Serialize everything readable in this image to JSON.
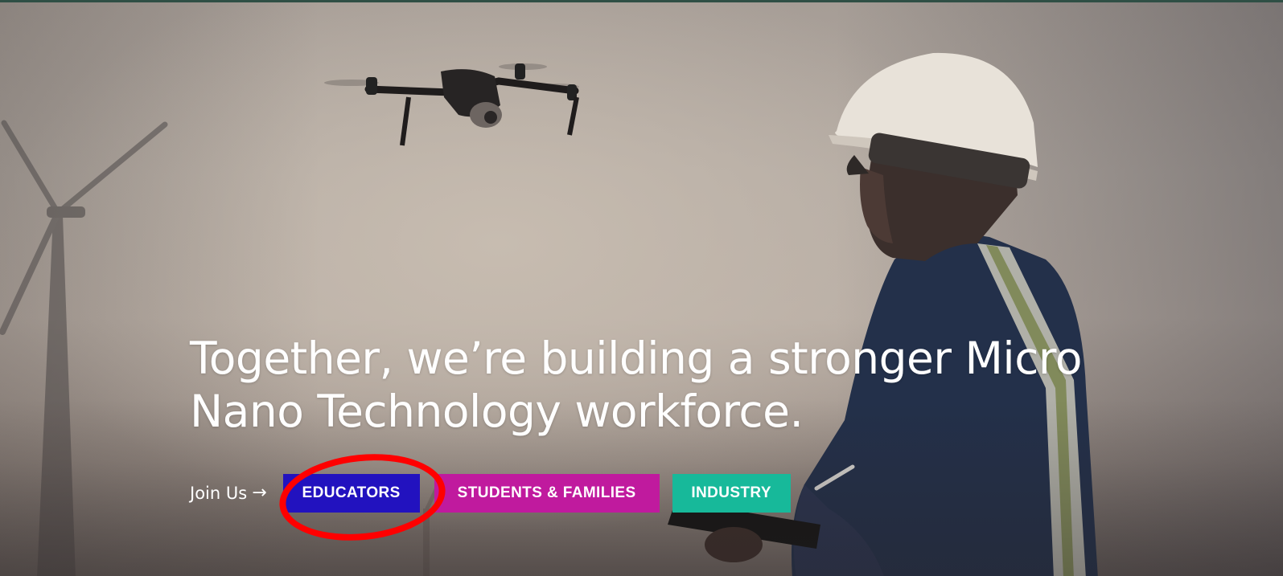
{
  "hero": {
    "headline": "Together, we’re building a stronger Micro Nano Technology workforce.",
    "join_label": "Join Us",
    "arrow_icon": "arrow-right-icon",
    "buttons": [
      {
        "label": "EDUCATORS",
        "color": "#2212bf"
      },
      {
        "label": "STUDENTS & FAMILIES",
        "color": "#c01a9e"
      },
      {
        "label": "INDUSTRY",
        "color": "#17b99a"
      }
    ],
    "annotation": {
      "target": "EDUCATORS",
      "color": "#ff0000"
    }
  }
}
